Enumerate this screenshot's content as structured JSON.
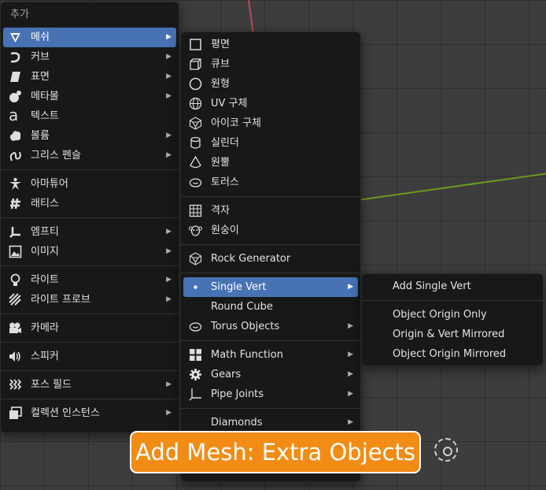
{
  "add_menu": {
    "title": "추가",
    "items": [
      {
        "label": "메쉬",
        "icon": "mesh-icon",
        "arrow": "▶"
      },
      {
        "label": "커브",
        "icon": "curve-icon",
        "arrow": "▶"
      },
      {
        "label": "표면",
        "icon": "surface-icon",
        "arrow": "▶"
      },
      {
        "label": "메타볼",
        "icon": "metaball-icon",
        "arrow": "▶"
      },
      {
        "label": "텍스트",
        "icon": "text-icon"
      },
      {
        "label": "볼륨",
        "icon": "volume-icon",
        "arrow": "▶"
      },
      {
        "label": "그리스 펜슬",
        "icon": "grease-pencil-icon",
        "arrow": "▶"
      },
      {
        "label": "아마튜어",
        "icon": "armature-icon"
      },
      {
        "label": "래티스",
        "icon": "lattice-icon"
      },
      {
        "label": "엠프티",
        "icon": "empty-icon",
        "arrow": "▶"
      },
      {
        "label": "이미지",
        "icon": "image-icon",
        "arrow": "▶"
      },
      {
        "label": "라이트",
        "icon": "light-icon",
        "arrow": "▶"
      },
      {
        "label": "라이트 프로브",
        "icon": "light-probe-icon",
        "arrow": "▶"
      },
      {
        "label": "카메라",
        "icon": "camera-icon"
      },
      {
        "label": "스피커",
        "icon": "speaker-icon"
      },
      {
        "label": "포스 필드",
        "icon": "force-field-icon",
        "arrow": "▶"
      },
      {
        "label": "컬렉션 인스턴스",
        "icon": "collection-instance-icon",
        "arrow": "▶"
      }
    ]
  },
  "mesh_menu": {
    "items": [
      {
        "label": "평면",
        "icon": "plane-icon"
      },
      {
        "label": "큐브",
        "icon": "cube-icon"
      },
      {
        "label": "원형",
        "icon": "circle-icon"
      },
      {
        "label": "UV 구체",
        "icon": "uv-sphere-icon"
      },
      {
        "label": "아이코 구체",
        "icon": "ico-sphere-icon"
      },
      {
        "label": "실린더",
        "icon": "cylinder-icon"
      },
      {
        "label": "원뿔",
        "icon": "cone-icon"
      },
      {
        "label": "토러스",
        "icon": "torus-icon"
      },
      {
        "label": "격자",
        "icon": "grid-icon"
      },
      {
        "label": "원숭이",
        "icon": "monkey-icon"
      },
      {
        "label": "Rock Generator",
        "icon": "rock-icon"
      },
      {
        "label": "Single Vert",
        "icon": "vertex-icon",
        "arrow": "▶"
      },
      {
        "label": "Round Cube",
        "icon": ""
      },
      {
        "label": "Torus Objects",
        "icon": "torus-objects-icon",
        "arrow": "▶"
      },
      {
        "label": "Math Function",
        "icon": "math-function-icon",
        "arrow": "▶"
      },
      {
        "label": "Gears",
        "icon": "gear-icon",
        "arrow": "▶"
      },
      {
        "label": "Pipe Joints",
        "icon": "pipe-joints-icon",
        "arrow": "▶"
      },
      {
        "label": "Diamonds",
        "icon": "",
        "arrow": "▶"
      }
    ]
  },
  "single_vert_menu": {
    "items": [
      {
        "label": "Add Single Vert"
      },
      {
        "label": "Object Origin Only"
      },
      {
        "label": "Origin & Vert Mirrored"
      },
      {
        "label": "Object Origin Mirrored"
      }
    ]
  },
  "overlay_label": "Add Mesh: Extra Objects",
  "colors": {
    "accent": "#4772b3",
    "overlay": "#f28c14",
    "menu_bg": "#181818"
  }
}
